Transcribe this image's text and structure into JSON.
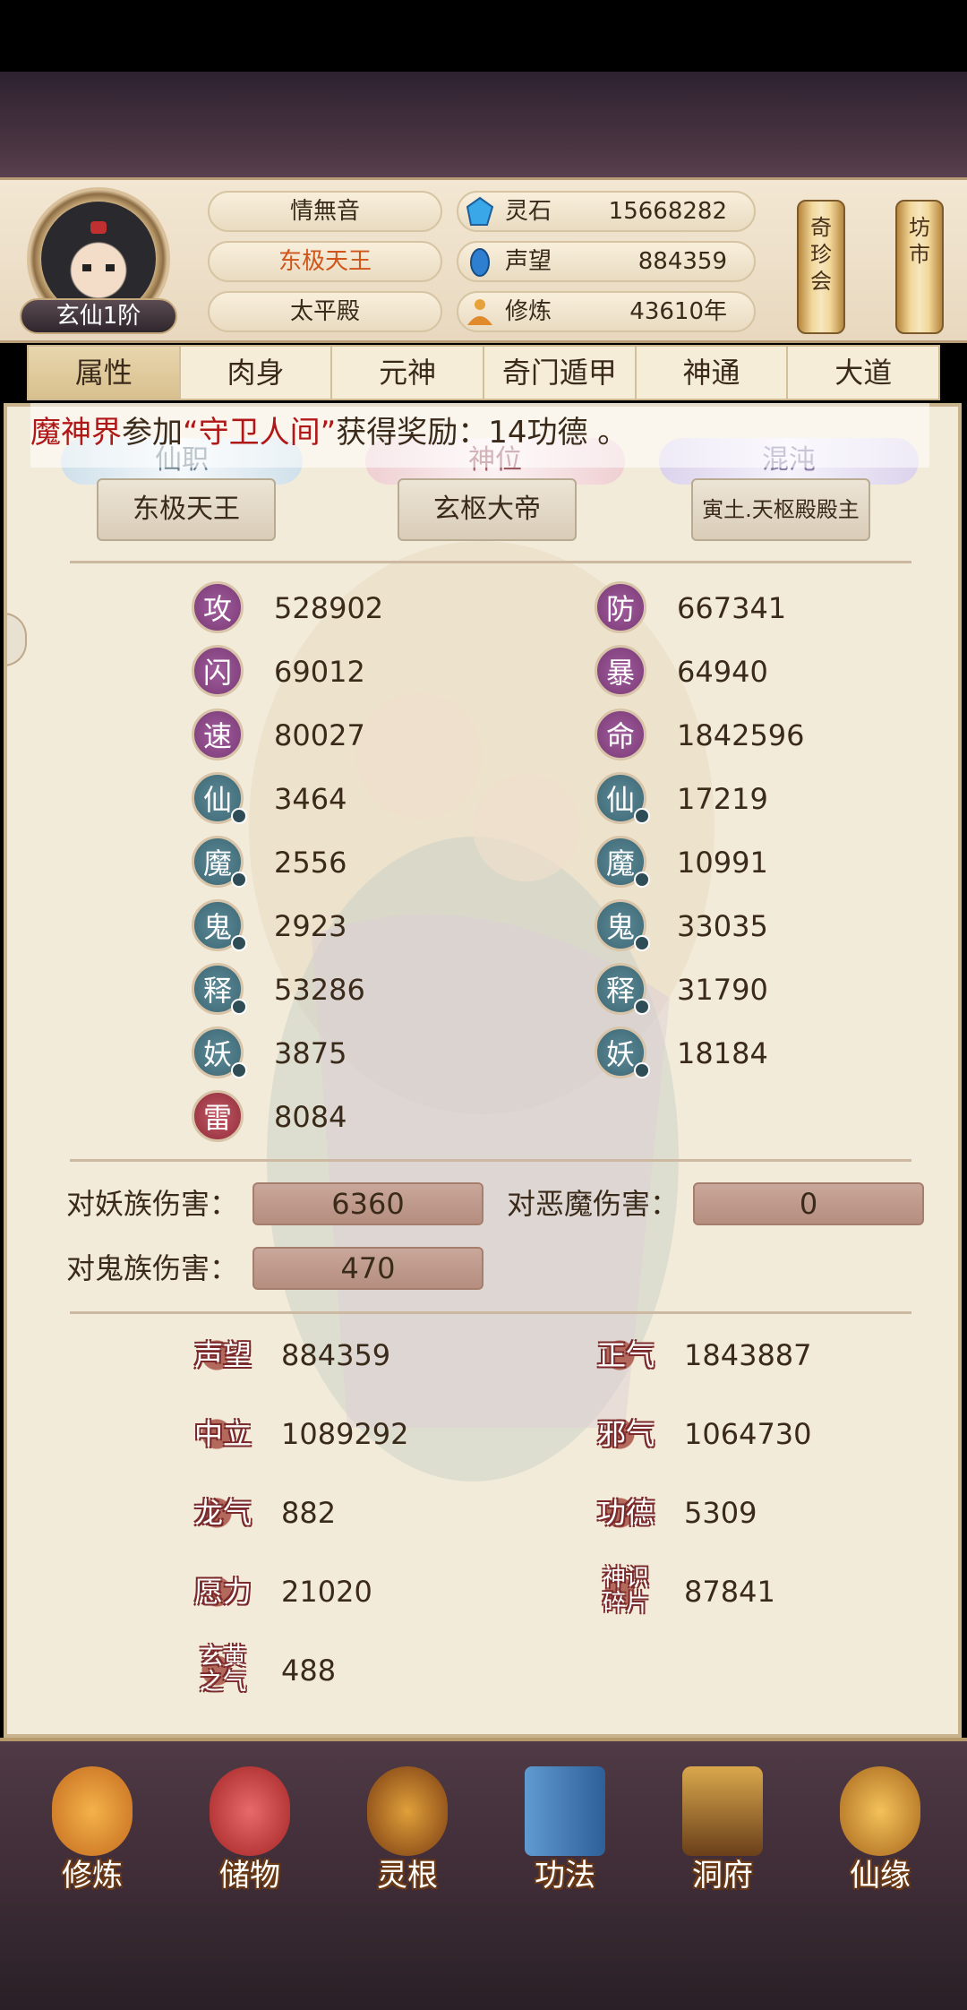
{
  "header": {
    "rank": "玄仙1阶",
    "player_name": "情無音",
    "title": "东极天王",
    "palace": "太平殿",
    "resources": [
      {
        "icon": "spirit-stone-icon",
        "label": "灵石",
        "value": "15668282"
      },
      {
        "icon": "reputation-icon",
        "label": "声望",
        "value": "884359"
      },
      {
        "icon": "cultivation-icon",
        "label": "修炼",
        "value": "43610年"
      }
    ],
    "side_buttons": [
      "奇珍会",
      "坊市"
    ]
  },
  "tabs": [
    "属性",
    "肉身",
    "元神",
    "奇门遁甲",
    "神通",
    "大道"
  ],
  "ticker": {
    "prefix": "魔神界",
    "mid": "参加",
    "quote": "“守卫人间”",
    "rest": "获得奖励：14功德 。"
  },
  "titles": {
    "xianzhi": {
      "label": "仙职",
      "value": "东极天王"
    },
    "shenwei": {
      "label": "神位",
      "value": "玄枢大帝"
    },
    "hundun": {
      "label": "混沌",
      "value": "寅土.天枢殿殿主"
    }
  },
  "stats_left": [
    {
      "char": "攻",
      "value": "528902",
      "color": "purple"
    },
    {
      "char": "闪",
      "value": "69012",
      "color": "purple"
    },
    {
      "char": "速",
      "value": "80027",
      "color": "purple"
    },
    {
      "char": "仙",
      "value": "3464",
      "color": "teal"
    },
    {
      "char": "魔",
      "value": "2556",
      "color": "teal"
    },
    {
      "char": "鬼",
      "value": "2923",
      "color": "teal"
    },
    {
      "char": "释",
      "value": "53286",
      "color": "teal"
    },
    {
      "char": "妖",
      "value": "3875",
      "color": "teal"
    },
    {
      "char": "雷",
      "value": "8084",
      "color": "red"
    }
  ],
  "stats_right": [
    {
      "char": "防",
      "value": "667341",
      "color": "purple"
    },
    {
      "char": "暴",
      "value": "64940",
      "color": "purple"
    },
    {
      "char": "命",
      "value": "1842596",
      "color": "purple"
    },
    {
      "char": "仙",
      "value": "17219",
      "color": "teal"
    },
    {
      "char": "魔",
      "value": "10991",
      "color": "teal"
    },
    {
      "char": "鬼",
      "value": "33035",
      "color": "teal"
    },
    {
      "char": "释",
      "value": "31790",
      "color": "teal"
    },
    {
      "char": "妖",
      "value": "18184",
      "color": "teal"
    }
  ],
  "damage": [
    {
      "label": "对妖族伤害：",
      "value": "6360"
    },
    {
      "label": "对恶魔伤害：",
      "value": "0"
    },
    {
      "label": "对鬼族伤害：",
      "value": "470"
    }
  ],
  "bottom_stats_left": [
    {
      "label": "声望",
      "value": "884359"
    },
    {
      "label": "中立",
      "value": "1089292"
    },
    {
      "label": "龙气",
      "value": "882"
    },
    {
      "label": "愿力",
      "value": "21020"
    },
    {
      "label": "玄黄之气",
      "value": "488"
    }
  ],
  "bottom_stats_right": [
    {
      "label": "正气",
      "value": "1843887"
    },
    {
      "label": "邪气",
      "value": "1064730"
    },
    {
      "label": "功德",
      "value": "5309"
    },
    {
      "label": "神识碎片",
      "value": "87841"
    }
  ],
  "nav": [
    {
      "label": "修炼",
      "icon": "meditating-monk-icon"
    },
    {
      "label": "储物",
      "icon": "storage-bag-icon"
    },
    {
      "label": "灵根",
      "icon": "spirit-root-icon"
    },
    {
      "label": "功法",
      "icon": "scripture-book-icon"
    },
    {
      "label": "洞府",
      "icon": "cave-dwelling-icon"
    },
    {
      "label": "仙缘",
      "icon": "gourd-icon"
    }
  ]
}
